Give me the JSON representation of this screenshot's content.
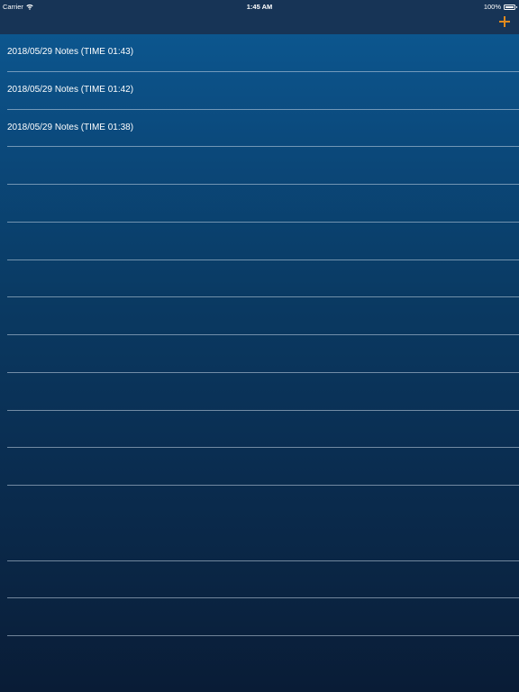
{
  "status_bar": {
    "carrier": "Carrier",
    "time": "1:45 AM",
    "battery": "100%",
    "battery_level": 1.0,
    "icons": [
      "wifi-icon",
      "battery-icon"
    ]
  },
  "nav_bar": {
    "add_icon": "plus-icon",
    "add_color": "#e08a1e"
  },
  "notes": [
    {
      "title": "2018/05/29 Notes (TIME 01:43)"
    },
    {
      "title": "2018/05/29 Notes (TIME 01:42)"
    },
    {
      "title": "2018/05/29 Notes (TIME 01:38)"
    }
  ],
  "colors": {
    "nav_background": "#173456",
    "list_top": "#0d5a94",
    "list_bottom": "#091c36",
    "separator": "#c8d7e6"
  }
}
